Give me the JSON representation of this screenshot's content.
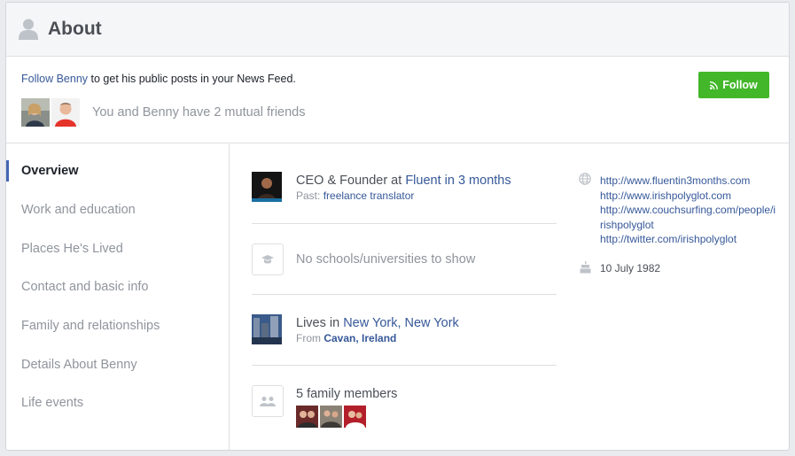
{
  "header": {
    "title": "About",
    "icon": "person-icon"
  },
  "follow": {
    "prompt_link": "Follow Benny",
    "prompt_rest": " to get his public posts in your News Feed.",
    "button_label": "Follow",
    "mutual_text": "You and Benny have 2 mutual friends"
  },
  "sidebar": {
    "items": [
      {
        "label": "Overview"
      },
      {
        "label": "Work and education"
      },
      {
        "label": "Places He's Lived"
      },
      {
        "label": "Contact and basic info"
      },
      {
        "label": "Family and relationships"
      },
      {
        "label": "Details About Benny"
      },
      {
        "label": "Life events"
      }
    ]
  },
  "overview": {
    "work": {
      "prefix": "CEO & Founder at ",
      "link": "Fluent in 3 months",
      "past_label": "Past: ",
      "past_link": "freelance translator"
    },
    "education": {
      "text": "No schools/universities to show"
    },
    "lives": {
      "prefix": "Lives in ",
      "link": "New York, New York",
      "from_label": "From ",
      "from_link": "Cavan, Ireland"
    },
    "family": {
      "text": "5 family members"
    }
  },
  "contact": {
    "links": [
      "http://www.fluentin3months.com",
      "http://www.irishpolyglot.com",
      "http://www.couchsurfing.com/people/irishpolyglot",
      "http://twitter.com/irishpolyglot"
    ],
    "birthday": "10 July 1982"
  },
  "colors": {
    "accent": "#4267b2",
    "link": "#365899",
    "follow_green": "#42b72a"
  }
}
